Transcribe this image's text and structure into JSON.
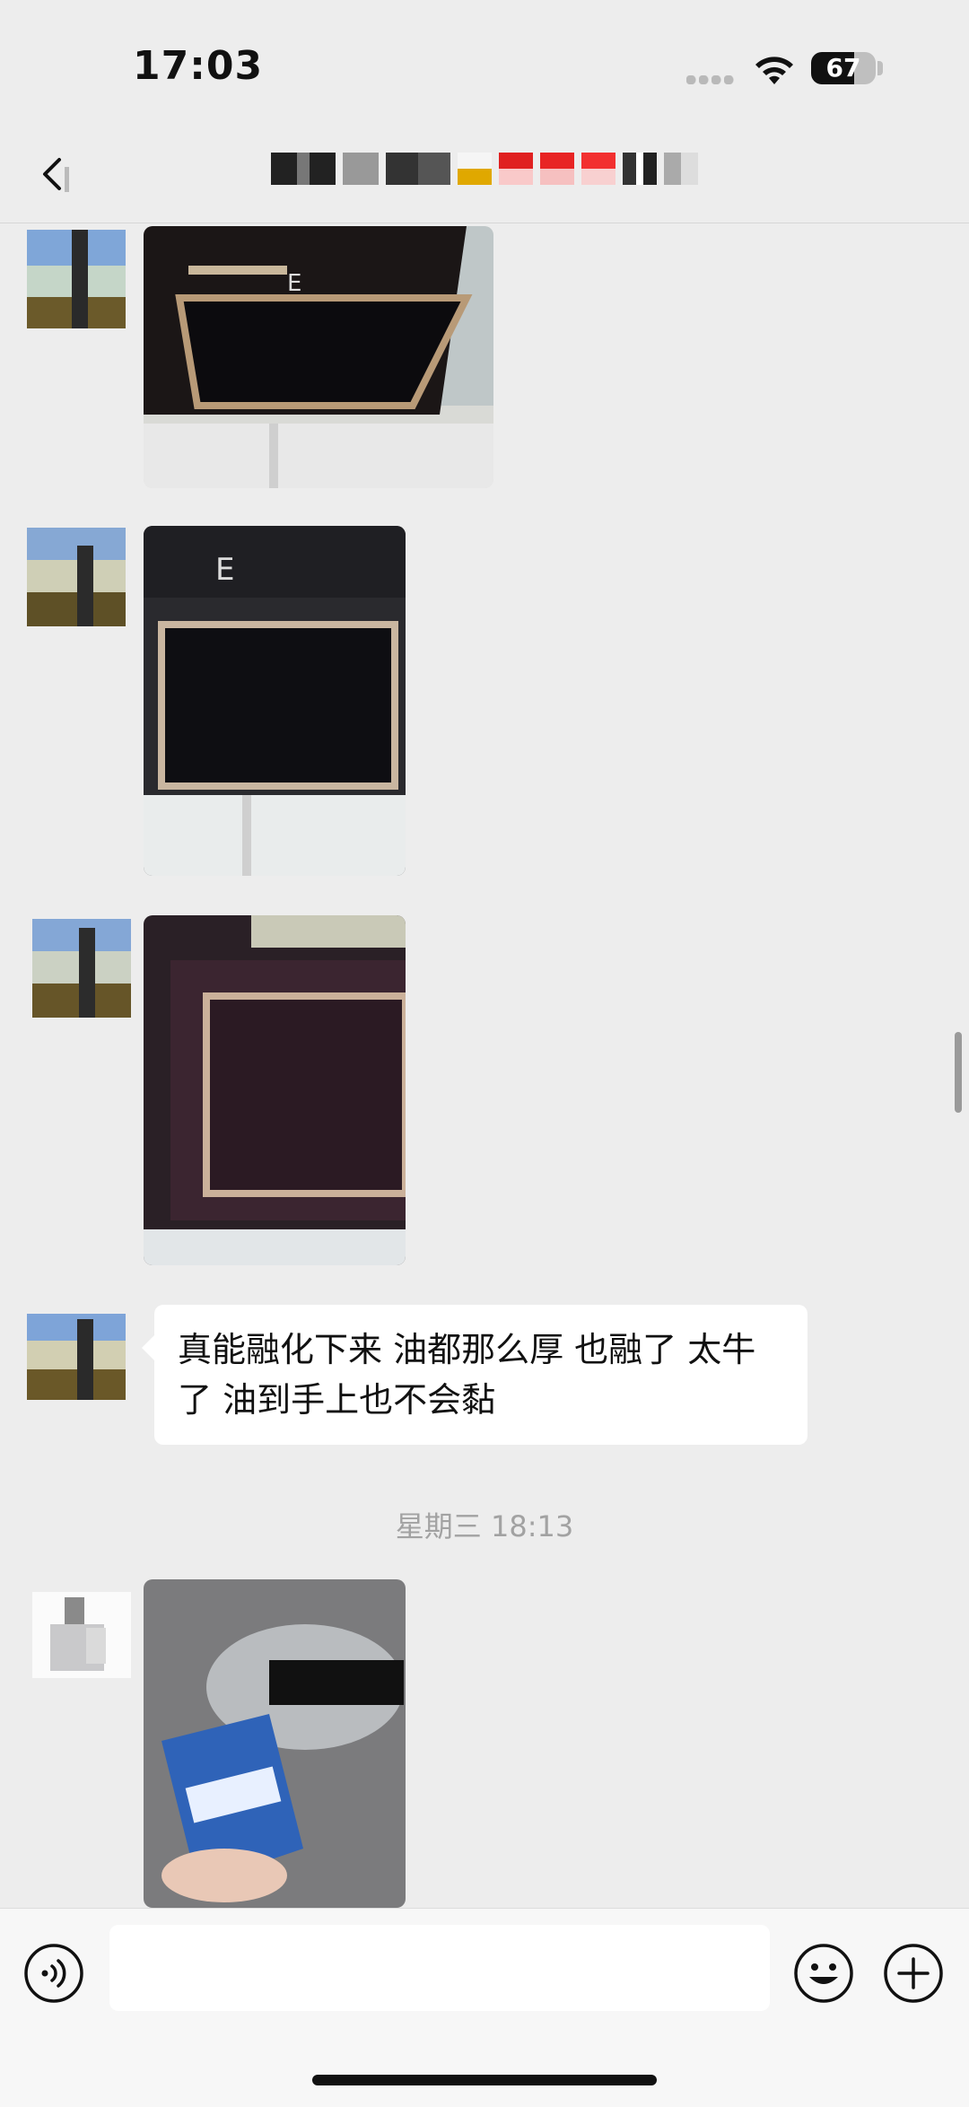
{
  "status_bar": {
    "time": "17:03",
    "battery": "67"
  },
  "nav": {
    "title": ""
  },
  "messages": [
    {
      "type": "image",
      "description": "range-hood-photo-1"
    },
    {
      "type": "image",
      "description": "range-hood-photo-2"
    },
    {
      "type": "image",
      "description": "range-hood-photo-3"
    },
    {
      "type": "text",
      "text": "真能融化下来 油都那么厚 也融了  太牛了 油到手上也不会黏"
    },
    {
      "type": "timestamp",
      "text": "星期三 18:13"
    },
    {
      "type": "image",
      "description": "cleaner-bottle-photo"
    }
  ],
  "input_bar": {
    "placeholder": ""
  }
}
